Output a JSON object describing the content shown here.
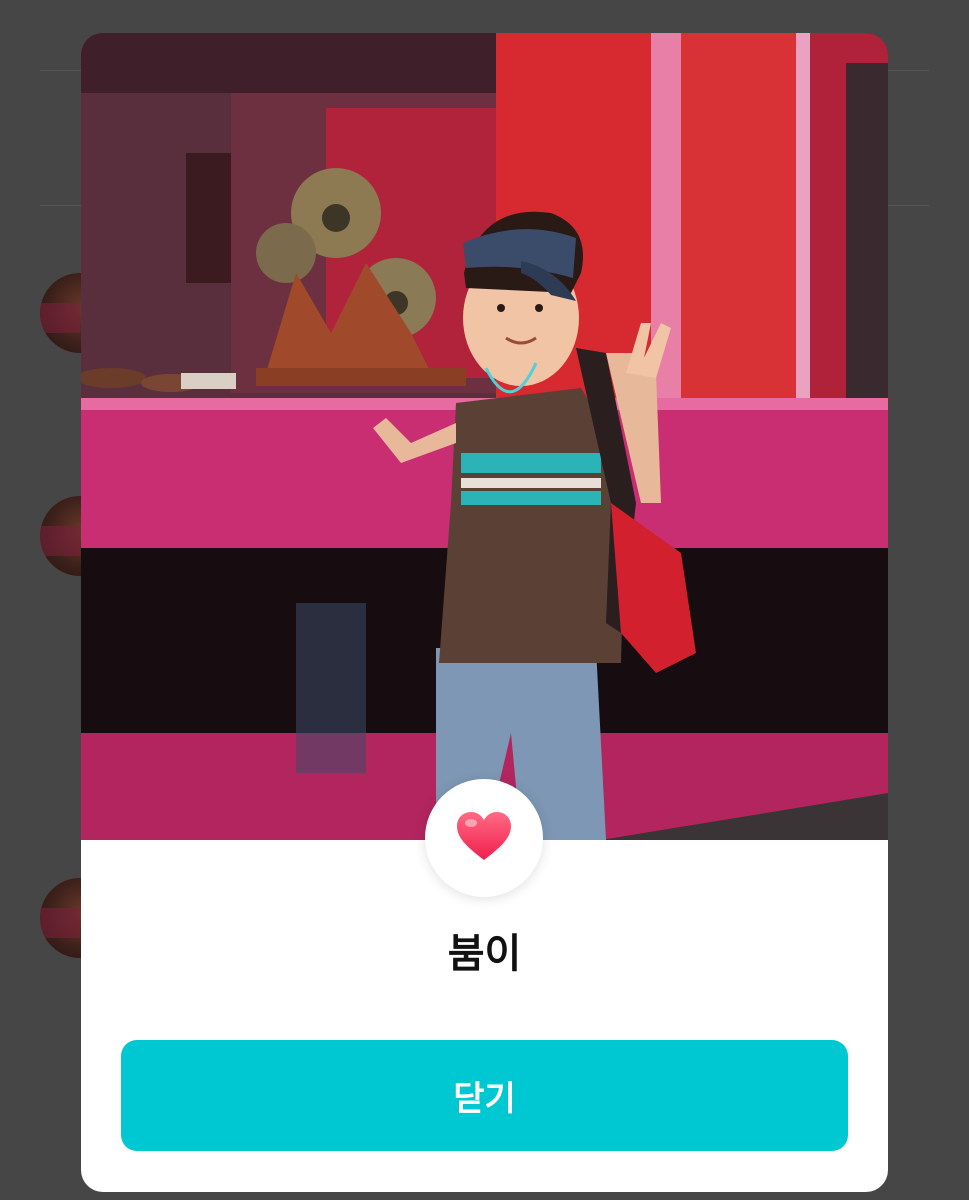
{
  "modal": {
    "name": "붐이",
    "close_label": "닫기",
    "badge_icon": "heart-icon"
  },
  "colors": {
    "overlay": "#464646",
    "accent": "#00C8D2",
    "heart": "#FF3B63",
    "modal_bg": "#FFFFFF"
  }
}
